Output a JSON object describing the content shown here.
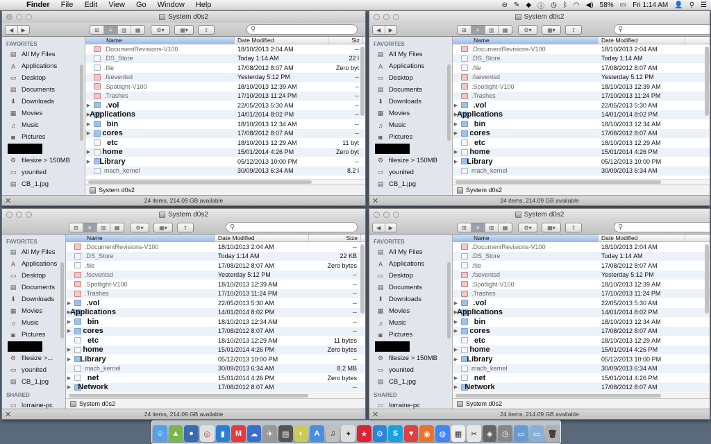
{
  "menubar": {
    "apple": "",
    "items": [
      "Finder",
      "File",
      "Edit",
      "View",
      "Go",
      "Window",
      "Help"
    ],
    "battery": "58%",
    "clock": "Fri 1:14 AM"
  },
  "window_title": "System d0s2",
  "search_placeholder": "",
  "sidebar": {
    "favorites_header": "FAVORITES",
    "shared_header": "SHARED",
    "items": [
      "All My Files",
      "Applications",
      "Desktop",
      "Documents",
      "Downloads",
      "Movies",
      "Music",
      "Pictures"
    ],
    "items2": [
      "filesize > 150MB",
      "younited",
      "CB_1.jpg"
    ],
    "items2_short": [
      "filesize >...",
      "younited",
      "CB_1.jpg"
    ],
    "shared": [
      "lorraine-pc"
    ]
  },
  "columns": {
    "name": "Name",
    "date": "Date Modified",
    "size": "Size",
    "size_short": "Siz"
  },
  "files": [
    {
      "name": ".DocumentRevisions-V100",
      "date": "18/10/2013 2:04 AM",
      "size": "--",
      "size_cut": "--",
      "kind": "red",
      "disclose": false
    },
    {
      "name": ".DS_Store",
      "date": "Today 1:14 AM",
      "size": "22 KB",
      "size_cut": "22 l",
      "kind": "doc",
      "disclose": false
    },
    {
      "name": ".file",
      "date": "17/08/2012 8:07 AM",
      "size": "Zero bytes",
      "size_cut": "Zero byt",
      "kind": "doc",
      "disclose": false
    },
    {
      "name": ".fseventsd",
      "date": "Yesterday 5:12 PM",
      "size": "--",
      "size_cut": "--",
      "kind": "red",
      "disclose": false
    },
    {
      "name": ".Spotlight-V100",
      "date": "18/10/2013 12:39 AM",
      "size": "--",
      "size_cut": "--",
      "kind": "red",
      "disclose": false
    },
    {
      "name": ".Trashes",
      "date": "17/10/2013 11:24 PM",
      "size": "--",
      "size_cut": "--",
      "kind": "red",
      "disclose": false
    },
    {
      "name": ".vol",
      "date": "22/05/2013 5:30 AM",
      "size": "--",
      "size_cut": "--",
      "kind": "folder",
      "disclose": true
    },
    {
      "name": "Applications",
      "date": "14/01/2014 8:02 PM",
      "size": "--",
      "size_cut": "--",
      "kind": "folder",
      "disclose": true
    },
    {
      "name": "bin",
      "date": "18/10/2013 12:34 AM",
      "size": "--",
      "size_cut": "--",
      "kind": "folder",
      "disclose": true
    },
    {
      "name": "cores",
      "date": "17/08/2012 8:07 AM",
      "size": "--",
      "size_cut": "--",
      "kind": "folder",
      "disclose": true
    },
    {
      "name": "etc",
      "date": "18/10/2013 12:29 AM",
      "size": "11 bytes",
      "size_cut": "11 byt",
      "kind": "doc",
      "disclose": false
    },
    {
      "name": "home",
      "date": "15/01/2014 4:26 PM",
      "size": "Zero bytes",
      "size_cut": "Zero byt",
      "kind": "doc",
      "disclose": true
    },
    {
      "name": "Library",
      "date": "05/12/2013 10:00 PM",
      "size": "--",
      "size_cut": "--",
      "kind": "folder",
      "disclose": true
    },
    {
      "name": "mach_kernel",
      "date": "30/09/2013 6:34 AM",
      "size": "8.2 MB",
      "size_cut": "8.2 l",
      "kind": "doc",
      "disclose": false
    },
    {
      "name": "net",
      "date": "15/01/2014 4:26 PM",
      "size": "Zero bytes",
      "size_cut": "Zero byt",
      "kind": "doc",
      "disclose": true
    },
    {
      "name": "Network",
      "date": "17/08/2012 8:07 AM",
      "size": "--",
      "size_cut": "--",
      "kind": "folder",
      "disclose": true
    }
  ],
  "path_label": "System d0s2",
  "status_text": "24 items, 214.09 GB available",
  "status_close": "✕"
}
